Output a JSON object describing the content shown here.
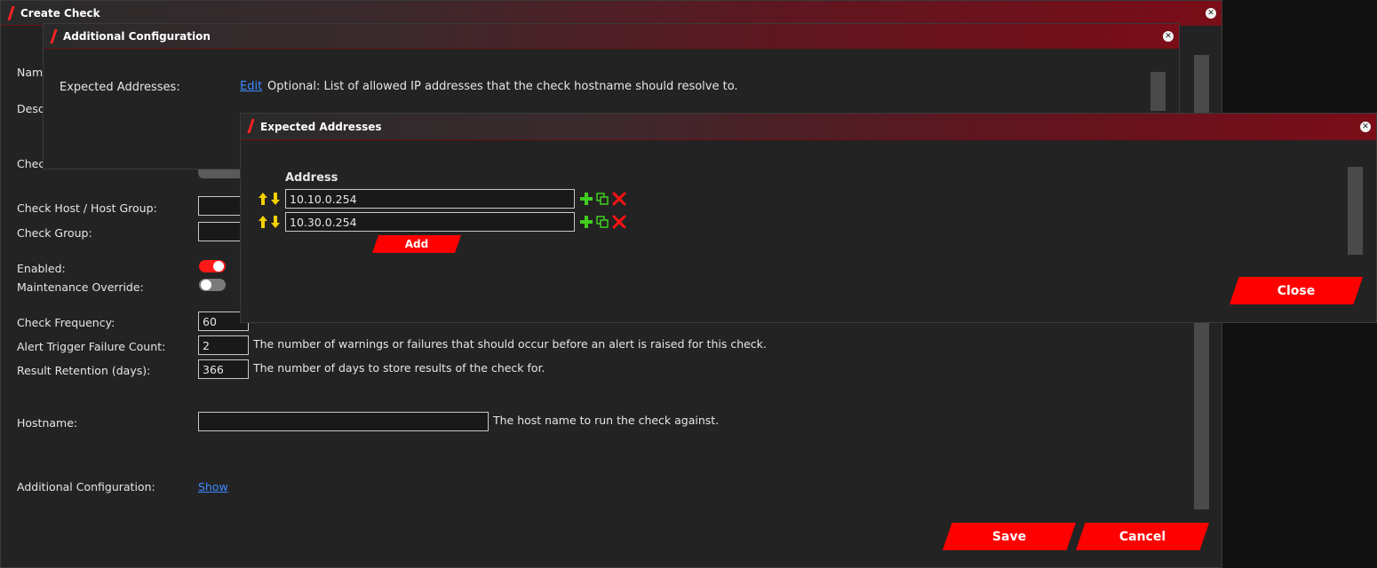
{
  "create_check": {
    "title": "Create Check",
    "name_label": "Name",
    "description_label": "Desc",
    "check_type_label": "Chec",
    "host_label": "Check Host / Host Group:",
    "group_label": "Check Group:",
    "enabled_label": "Enabled:",
    "maintenance_label": "Maintenance Override:",
    "frequency_label": "Check Frequency:",
    "frequency_value": "60",
    "failure_count_label": "Alert Trigger Failure Count:",
    "failure_count_value": "2",
    "failure_count_help": "The number of warnings or failures that should occur before an alert is raised for this check.",
    "retention_label": "Result Retention (days):",
    "retention_value": "366",
    "retention_help": "The number of days to store results of the check for.",
    "hostname_label": "Hostname:",
    "hostname_value": "",
    "hostname_help": "The host name to run the check against.",
    "additional_label": "Additional Configuration:",
    "show_link": "Show",
    "save_label": "Save",
    "cancel_label": "Cancel"
  },
  "additional_config": {
    "title": "Additional Configuration",
    "expected_label": "Expected Addresses:",
    "edit_link": "Edit",
    "expected_help": "Optional: List of allowed IP addresses that the check hostname should resolve to."
  },
  "expected_addresses": {
    "title": "Expected Addresses",
    "column_header": "Address",
    "rows": [
      {
        "value": "10.10.0.254"
      },
      {
        "value": "10.30.0.254"
      }
    ],
    "add_label": "Add",
    "close_label": "Close"
  },
  "colors": {
    "accent_red": "#ff0000",
    "link_blue": "#3d8bff",
    "arrow_yellow": "#f5d000",
    "add_green": "#3fcf1e",
    "delete_red": "#ff1111"
  }
}
